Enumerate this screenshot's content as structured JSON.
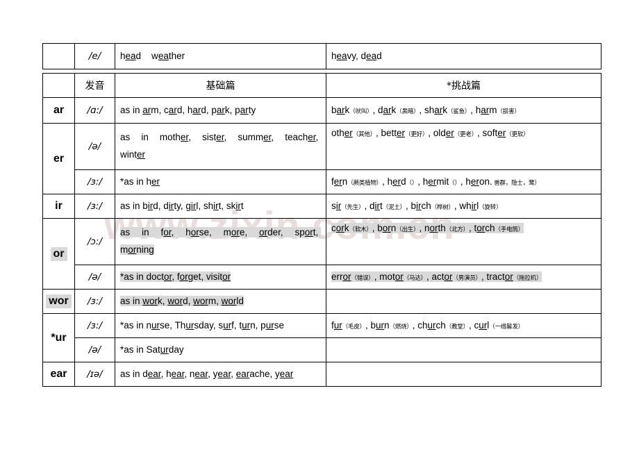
{
  "watermark": {
    "text": "www.zixin.com.cn"
  },
  "top_table": {
    "letter": "",
    "sound": "/e/",
    "basic": "head    weather",
    "challenge": "heavy, dead"
  },
  "main_table": {
    "headers": {
      "letter": "",
      "sound": "发音",
      "basic": "基础篇",
      "challenge": "*挑战篇"
    },
    "groups": [
      {
        "letter": "ar",
        "letter_highlight": false,
        "rows": [
          {
            "sound": "/ɑ:/",
            "basic": "as in arm, card, hard, park, party",
            "basic_highlight": false,
            "challenge": "bark（吠叫）, dark（黑暗）, shark（鲨鱼）, harm（损害）",
            "challenge_highlight": false
          }
        ]
      },
      {
        "letter": "er",
        "letter_highlight": false,
        "rows": [
          {
            "sound": "/ə/",
            "basic": "as in mother, sister, summer, teacher, winter",
            "basic_highlight": false,
            "challenge": "other（其他）, better（更好）, older（更老）, softer（更软）",
            "challenge_highlight": false
          },
          {
            "sound": "/ɜ:/",
            "basic": "*as in her",
            "basic_highlight": false,
            "challenge": "fern（蕨类植物）, herd（）, hermit（）, heron. 兽群，隐士，鹭）",
            "challenge_highlight": false
          }
        ]
      },
      {
        "letter": "ir",
        "letter_highlight": false,
        "rows": [
          {
            "sound": "/ɜ:/",
            "basic": "as in bird, dirty, girl, shirt, skirt",
            "basic_highlight": false,
            "challenge": "sir（先生）, dirt（泥土）, birch（桦树）, whirl（旋转）",
            "challenge_highlight": false
          }
        ]
      },
      {
        "letter": "or",
        "letter_highlight": true,
        "rows": [
          {
            "sound": "/ɔ:/",
            "basic": "as in for, horse, more, order, sport, morning",
            "basic_highlight": true,
            "challenge": "cork（软木）, born（出生）, north（北方）, torch（手电筒）",
            "challenge_highlight": true
          },
          {
            "sound": "/ə/",
            "basic": "*as in doctor, forget, visitor",
            "basic_highlight": true,
            "challenge": "error（错误）, motor（马达）, actor（男演员）, tractor（拖拉机）",
            "challenge_highlight": true
          }
        ]
      },
      {
        "letter": "wor",
        "letter_highlight": true,
        "rows": [
          {
            "sound": "/ɜ:/",
            "basic": "as in work, word, worm, world",
            "basic_highlight": true,
            "challenge": "",
            "challenge_highlight": false
          }
        ]
      },
      {
        "letter": "*ur",
        "letter_highlight": false,
        "rows": [
          {
            "sound": "/ɜ:/",
            "basic": "*as in nurse, Thursday, surf, turn, purse",
            "basic_highlight": false,
            "challenge": "fur（毛皮）, burn（燃烧）, church（教堂）, curl（一纺鲍发）",
            "challenge_highlight": false
          },
          {
            "sound": "/ə/",
            "basic": "*as in Saturday",
            "basic_highlight": false,
            "challenge": "",
            "challenge_highlight": false
          }
        ]
      },
      {
        "letter": "ear",
        "letter_highlight": false,
        "rows": [
          {
            "sound": "/ɪə/",
            "basic": "as in dear, hear, near, year, earache, year",
            "basic_highlight": false,
            "challenge": "",
            "challenge_highlight": false
          }
        ]
      }
    ]
  },
  "colors": {
    "highlight": "#d9d9d9",
    "border": "#000000",
    "inner_border": "#a6a6a6",
    "watermark": "#e9dede"
  }
}
